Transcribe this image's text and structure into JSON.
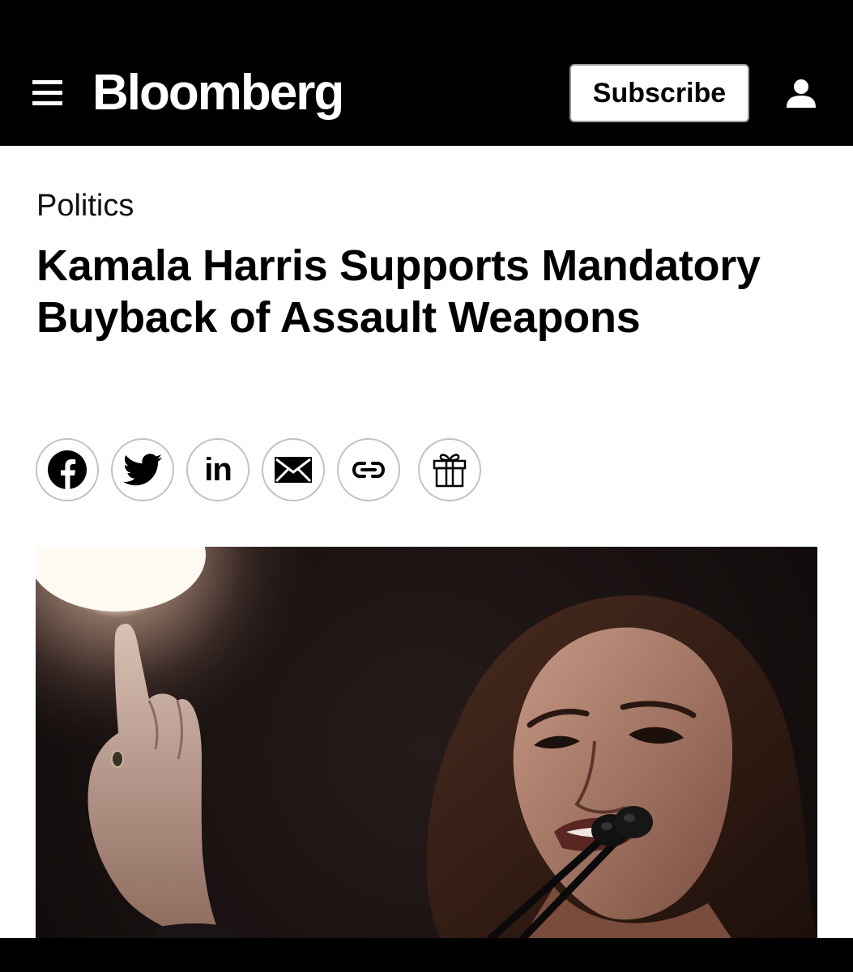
{
  "header": {
    "logo": "Bloomberg",
    "subscribe_label": "Subscribe",
    "menu_icon": "menu-icon",
    "account_icon": "user-icon"
  },
  "article": {
    "section": "Politics",
    "headline": "Kamala Harris Supports Mandatory Buyback of Assault Weapons",
    "share_buttons": [
      {
        "icon": "facebook-icon"
      },
      {
        "icon": "twitter-icon"
      },
      {
        "icon": "linkedin-icon",
        "label": "in"
      },
      {
        "icon": "email-icon"
      },
      {
        "icon": "link-icon"
      },
      {
        "icon": "gift-icon"
      }
    ],
    "hero_image": "photo-of-speaker-pointing-upward-at-microphone"
  },
  "colors": {
    "header_bg": "#000000",
    "page_bg": "#ffffff",
    "share_border": "#c2c2c2"
  }
}
